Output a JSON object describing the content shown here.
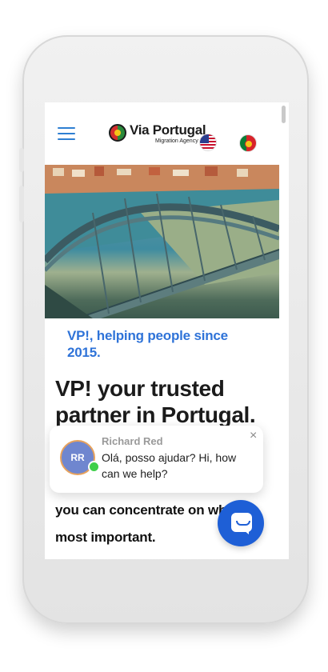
{
  "header": {
    "menu_icon": "hamburger-icon",
    "logo": {
      "name": "Via Portugal",
      "subtitle": "Migration Agency"
    },
    "languages": [
      {
        "icon": "flag-us-icon",
        "label": "English"
      },
      {
        "icon": "flag-pt-icon",
        "label": "Português"
      }
    ]
  },
  "hero": {
    "image": "bridge-over-river-photo"
  },
  "tagline": "VP!, helping people since 2015.",
  "heading": "VP! your trusted partner in Portugal.",
  "body_text": "you can concentrate on what's most important.",
  "chat": {
    "avatar_initials": "RR",
    "agent_name": "Richard Red",
    "message": "Olá, posso ajudar? Hi, how can we help?",
    "close_symbol": "×",
    "launcher_icon": "chat-bubble-icon"
  },
  "colors": {
    "accent": "#2f73d8",
    "launcher": "#1e5fd6",
    "online": "#3fcf4a"
  }
}
